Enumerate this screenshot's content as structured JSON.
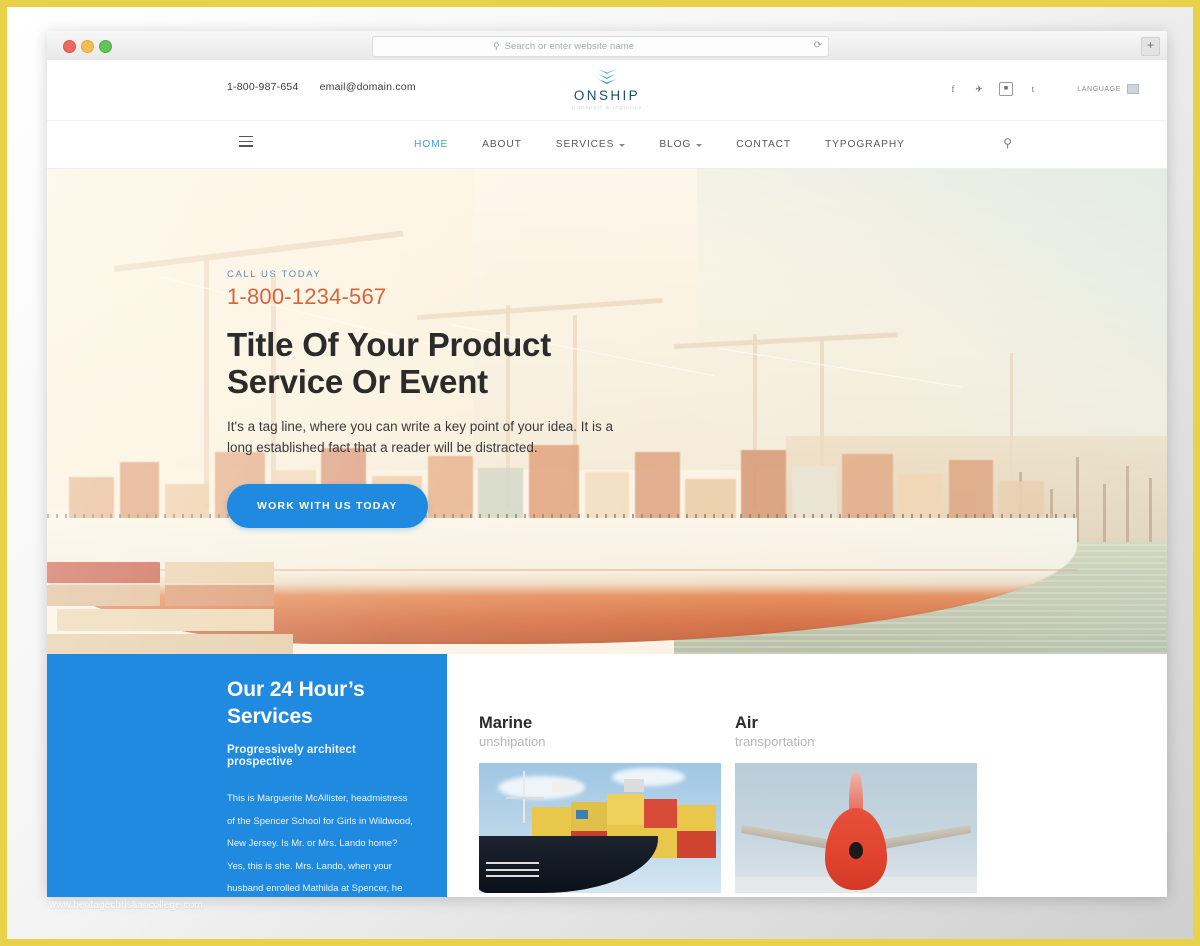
{
  "browser": {
    "omnibox_placeholder": "Search or enter website name",
    "search_icon": "search-icon",
    "reload_icon": "reload-icon",
    "newtab_label": "+",
    "traffic_lights": [
      "close",
      "minimize",
      "maximize"
    ]
  },
  "topbar": {
    "phone": "1-800-987-654",
    "email": "email@domain.com",
    "social": [
      {
        "name": "facebook-icon",
        "glyph": "f"
      },
      {
        "name": "twitter-icon",
        "glyph": "❧"
      },
      {
        "name": "instagram-icon",
        "glyph": "▣"
      },
      {
        "name": "tumblr-icon",
        "glyph": "t"
      }
    ],
    "language_label": "LANGUAGE",
    "language_flag": "flag-icon"
  },
  "logo": {
    "wordmark": "ONSHIP",
    "tagline": "transport & logistics",
    "mark": "chevron-stack-icon"
  },
  "nav": {
    "menu_icon": "hamburger-icon",
    "search_icon": "search-icon",
    "items": [
      {
        "label": "HOME",
        "active": true,
        "caret": false
      },
      {
        "label": "ABOUT",
        "active": false,
        "caret": false
      },
      {
        "label": "SERVICES",
        "active": false,
        "caret": true
      },
      {
        "label": "BLOG",
        "active": false,
        "caret": true
      },
      {
        "label": "CONTACT",
        "active": false,
        "caret": false
      },
      {
        "label": "TYPOGRAPHY",
        "active": false,
        "caret": false
      }
    ]
  },
  "hero": {
    "eyebrow": "CALL US TODAY",
    "phone": "1-800-1234-567",
    "title_line1": "Title Of Your Product",
    "title_line2": "Service Or Event",
    "subtitle": "It's a tag line, where you can write a key point of your idea. It is a long established fact that a reader will be distracted.",
    "cta_label": "WORK WITH US TODAY",
    "image_alt": "container-ship-at-port"
  },
  "services": {
    "heading_line1": "Our 24 Hour’s",
    "heading_line2": "Services",
    "lead": "Progressively architect prospective",
    "body": "This is Marguerite McAllister, headmistress of the Spencer School for Girls in Wildwood, New Jersey. Is Mr. or Mrs. Lando home? Yes, this is she. Mrs. Lando, when your husband enrolled Mathilda at Spencer, he told us she had",
    "cards": [
      {
        "title": "Marine",
        "subtitle": "unshipation",
        "image_alt": "cargo-ship-with-containers"
      },
      {
        "title": "Air",
        "subtitle": "transportation",
        "image_alt": "red-airplane-tail"
      }
    ]
  },
  "watermark": "www.heritagechristiancollege.com",
  "colors": {
    "accent_blue": "#2089e0",
    "nav_active": "#3f9fe0",
    "hero_phone": "#d9643b",
    "frame": "#e9d24a"
  }
}
